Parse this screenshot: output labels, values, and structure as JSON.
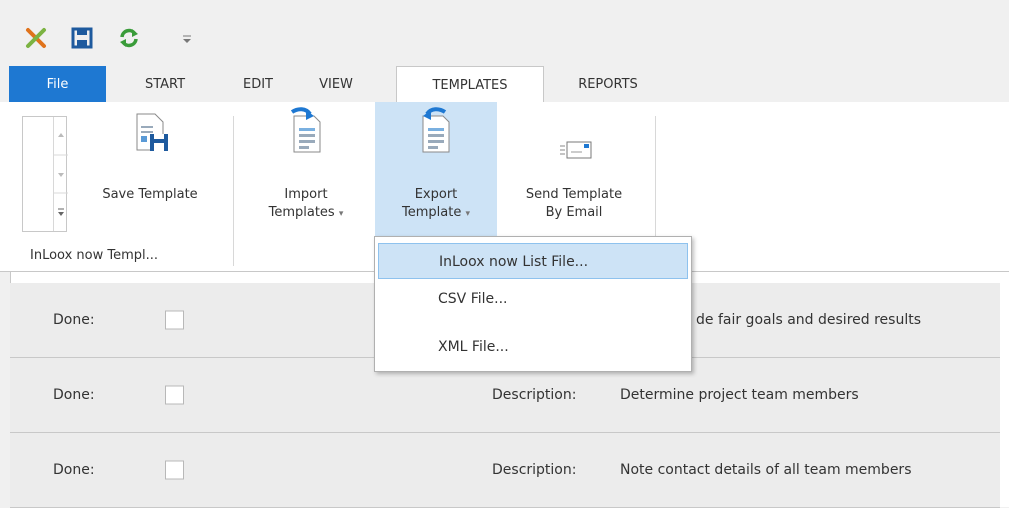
{
  "colors": {
    "file_tab": "#1e78d2",
    "ribbon_highlight": "#cde3f6",
    "accent_green": "#3a9c3a"
  },
  "quick_access": {
    "icons": [
      "app-logo-icon",
      "save-icon",
      "refresh-icon",
      "customize-qat-icon"
    ]
  },
  "tabs": [
    {
      "label": "File"
    },
    {
      "label": "START"
    },
    {
      "label": "EDIT"
    },
    {
      "label": "VIEW"
    },
    {
      "label": "TEMPLATES"
    },
    {
      "label": "REPORTS"
    }
  ],
  "ribbon": {
    "save_template": "Save Template",
    "import_templates_line1": "Import",
    "import_templates_line2": "Templates",
    "export_template_line1": "Export",
    "export_template_line2": "Template",
    "send_template_line1": "Send Template",
    "send_template_line2": "By Email",
    "group_label": "InLoox now Templ..."
  },
  "export_menu": {
    "items": [
      {
        "label": "InLoox now List File..."
      },
      {
        "label": "CSV File..."
      },
      {
        "label": "XML File..."
      }
    ]
  },
  "rows": [
    {
      "done_label": "Done:",
      "desc_label": "",
      "description": "de fair goals and desired results"
    },
    {
      "done_label": "Done:",
      "desc_label": "Description:",
      "description": "Determine project team members"
    },
    {
      "done_label": "Done:",
      "desc_label": "Description:",
      "description": "Note contact details of all team members"
    }
  ]
}
